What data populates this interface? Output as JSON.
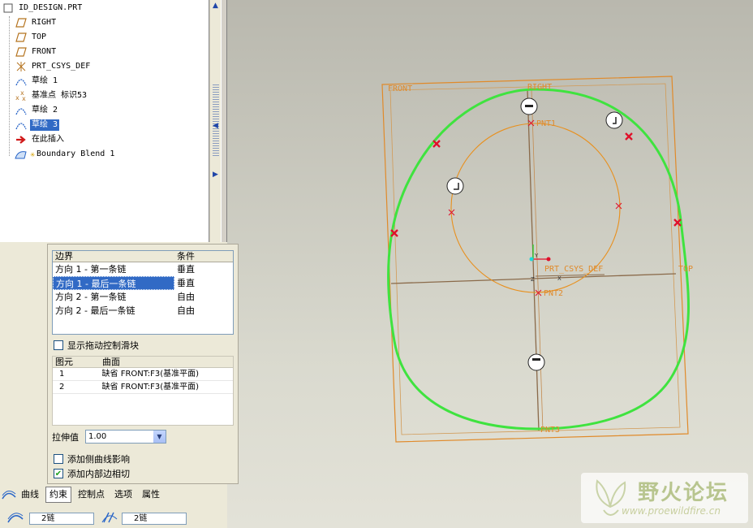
{
  "model_tree": {
    "items": [
      {
        "label": "ID_DESIGN.PRT",
        "icon": "part-icon",
        "indent": 0,
        "selected": false
      },
      {
        "label": "RIGHT",
        "icon": "datum-plane-icon",
        "indent": 1,
        "selected": false
      },
      {
        "label": "TOP",
        "icon": "datum-plane-icon",
        "indent": 1,
        "selected": false
      },
      {
        "label": "FRONT",
        "icon": "datum-plane-icon",
        "indent": 1,
        "selected": false
      },
      {
        "label": "PRT_CSYS_DEF",
        "icon": "csys-icon",
        "indent": 1,
        "selected": false
      },
      {
        "label": "草绘 1",
        "icon": "sketch-icon",
        "indent": 1,
        "selected": false
      },
      {
        "label": "基准点 标识53",
        "icon": "datum-point-icon",
        "indent": 1,
        "selected": false
      },
      {
        "label": "草绘 2",
        "icon": "sketch-icon",
        "indent": 1,
        "selected": false
      },
      {
        "label": "草绘 3",
        "icon": "sketch-icon",
        "indent": 1,
        "selected": true
      },
      {
        "label": "在此插入",
        "icon": "insert-arrow-icon",
        "indent": 1,
        "selected": false
      },
      {
        "label": "Boundary Blend 1",
        "icon": "boundary-blend-icon",
        "indent": 1,
        "selected": false
      }
    ]
  },
  "viewport_labels": {
    "front": "FRONT",
    "right": "RIGHT",
    "top": "TOP",
    "csys": "PRT_CSYS_DEF",
    "pnt1": "PNT1",
    "pnt2": "PNT2",
    "pnt3": "PNT3",
    "axis_y": "Y",
    "axis_z": "Z",
    "axis_x": "X"
  },
  "boundary_table": {
    "headers": [
      "边界",
      "条件"
    ],
    "rows": [
      {
        "boundary": "方向 1 - 第一条链",
        "condition": "垂直",
        "selected": false
      },
      {
        "boundary": "方向 1 - 最后一条链",
        "condition": "垂直",
        "selected": true
      },
      {
        "boundary": "方向 2 - 第一条链",
        "condition": "自由",
        "selected": false
      },
      {
        "boundary": "方向 2 - 最后一条链",
        "condition": "自由",
        "selected": false
      }
    ]
  },
  "show_drag_handles": {
    "label": "显示拖动控制滑块",
    "checked": false
  },
  "surface_table": {
    "headers": [
      "图元",
      "曲面"
    ],
    "rows": [
      {
        "element": "1",
        "surface": "缺省 FRONT:F3(基准平面)"
      },
      {
        "element": "2",
        "surface": "缺省 FRONT:F3(基准平面)"
      }
    ]
  },
  "tension": {
    "label": "拉伸值",
    "value": "1.00"
  },
  "options": [
    {
      "label": "添加侧曲线影响",
      "checked": false
    },
    {
      "label": "添加内部边相切",
      "checked": true
    }
  ],
  "tabs": [
    {
      "label": "曲线",
      "active": false
    },
    {
      "label": "约束",
      "active": true
    },
    {
      "label": "控制点",
      "active": false
    },
    {
      "label": "选项",
      "active": false
    },
    {
      "label": "属性",
      "active": false
    }
  ],
  "collectors": {
    "dir1": "2链",
    "dir2": "2链"
  },
  "watermark": {
    "name": "野火论坛",
    "url": "www.proewildfire.cn"
  },
  "colors": {
    "green_curve": "#3fe33f",
    "datum_orange": "#e08a2a",
    "selection_blue": "#316ac5",
    "marker_red": "#e0102a"
  }
}
